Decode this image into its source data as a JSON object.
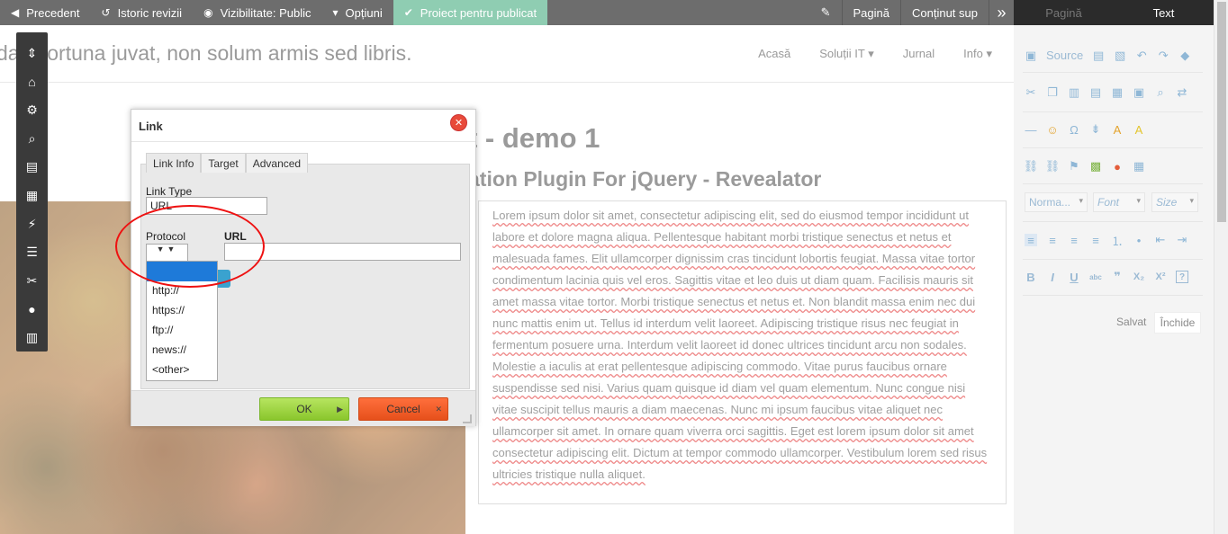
{
  "toolbar": {
    "prev": "Precedent",
    "history": "Istoric revizii",
    "visibility": "Vizibilitate: Public",
    "options": "Opțiuni",
    "publish": "Proiect pentru publicat",
    "page": "Pagină",
    "content": "Conținut sup"
  },
  "panel_tabs": {
    "page": "Pagină",
    "text": "Text"
  },
  "header": {
    "tagline": "da s fortuna juvat, non solum armis sed libris.",
    "nav": [
      "Acasă",
      "Soluții IT ▾",
      "Jurnal",
      "Info ▾"
    ]
  },
  "content": {
    "title": "t - demo 1",
    "subtitle": "ation Plugin For jQuery - Revealator",
    "body": "Lorem ipsum dolor sit amet, consectetur adipiscing elit, sed do eiusmod tempor incididunt ut labore et dolore magna aliqua. Pellentesque habitant morbi tristique senectus et netus et malesuada fames. Elit ullamcorper dignissim cras tincidunt lobortis feugiat. Massa vitae tortor condimentum lacinia quis vel eros. Sagittis vitae et leo duis ut diam quam. Facilisis mauris sit amet massa vitae tortor. Morbi tristique senectus et netus et. Non blandit massa enim nec dui nunc mattis enim ut. Tellus id interdum velit laoreet. Adipiscing tristique risus nec feugiat in fermentum posuere urna. Interdum velit laoreet id donec ultrices tincidunt arcu non sodales. Molestie a iaculis at erat pellentesque adipiscing commodo. Vitae purus faucibus ornare suspendisse sed nisi. Varius quam quisque id diam vel quam elementum. Nunc congue nisi vitae suscipit tellus mauris a diam maecenas. Nunc mi ipsum faucibus vitae aliquet nec ullamcorper sit amet. In ornare quam viverra orci sagittis. Eget est lorem ipsum dolor sit amet consectetur adipiscing elit. Dictum at tempor commodo ullamcorper. Vestibulum lorem sed risus ultricies tristique nulla aliquet."
  },
  "editor": {
    "source": "Source",
    "format": "Norma...",
    "font": "Font",
    "size": "Size",
    "saved": "Salvat",
    "close": "Închide"
  },
  "dialog": {
    "title": "Link",
    "tabs": [
      "Link Info",
      "Target",
      "Advanced"
    ],
    "link_type_label": "Link Type",
    "link_type_value": "URL",
    "protocol_label": "Protocol",
    "url_label": "URL",
    "url_value": "",
    "protocol_options": [
      "",
      "http://",
      "https://",
      "ftp://",
      "news://",
      "<other>"
    ],
    "ok": "OK",
    "cancel": "Cancel"
  }
}
